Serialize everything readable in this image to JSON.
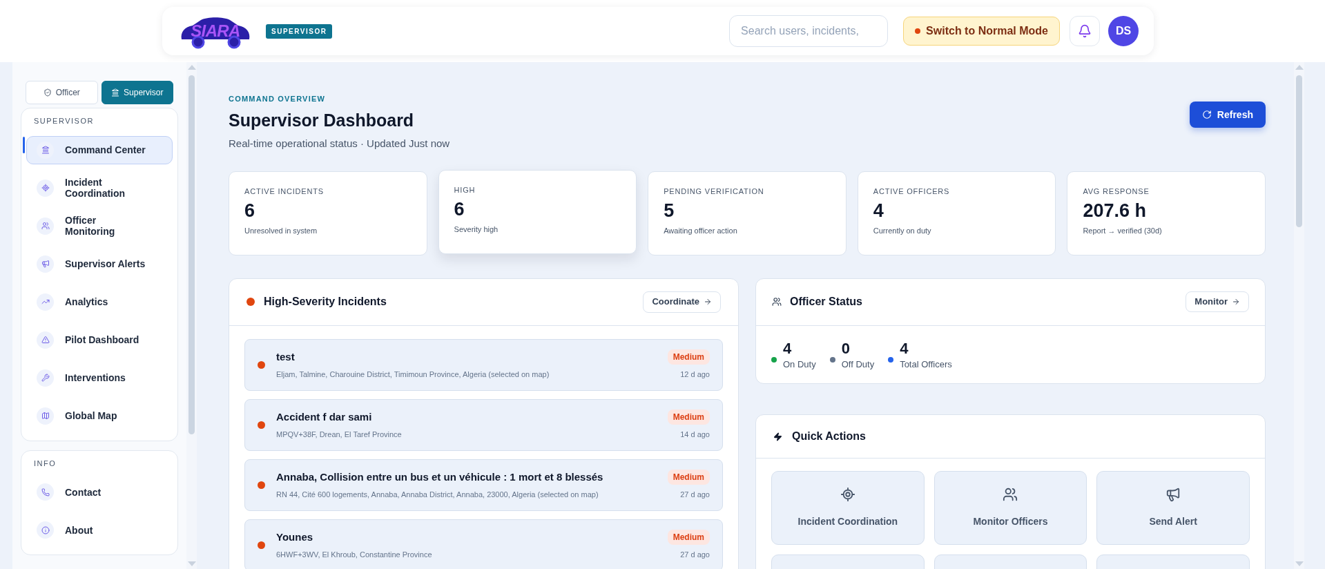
{
  "header": {
    "logo": "SIARA",
    "role_badge": "SUPERVISOR",
    "search": {
      "placeholder": "Search users, incidents,"
    },
    "mode_button": "Switch to Normal Mode",
    "avatar": "DS"
  },
  "sidebar": {
    "mode_tabs": [
      {
        "label": "Officer",
        "selected": false
      },
      {
        "label": "Supervisor",
        "selected": true
      }
    ],
    "sections": [
      {
        "title": "SUPERVISOR",
        "items": [
          {
            "label": "Command Center",
            "selected": true
          },
          {
            "label": "Incident Coordination",
            "selected": false
          },
          {
            "label": "Officer Monitoring",
            "selected": false
          },
          {
            "label": "Supervisor Alerts",
            "selected": false
          },
          {
            "label": "Analytics",
            "selected": false
          },
          {
            "label": "Pilot Dashboard",
            "selected": false
          },
          {
            "label": "Interventions",
            "selected": false
          },
          {
            "label": "Global Map",
            "selected": false
          }
        ]
      },
      {
        "title": "INFO",
        "items": [
          {
            "label": "Contact",
            "selected": false
          },
          {
            "label": "About",
            "selected": false
          }
        ]
      }
    ]
  },
  "page": {
    "eyebrow": "COMMAND OVERVIEW",
    "title": "Supervisor Dashboard",
    "subtitle": "Real-time operational status · Updated Just now",
    "refresh_button": "Refresh"
  },
  "stats": [
    {
      "label": "ACTIVE INCIDENTS",
      "value": "6",
      "caption": "Unresolved in system",
      "raised": false
    },
    {
      "label": "HIGH",
      "value": "6",
      "caption": "Severity high",
      "raised": true
    },
    {
      "label": "PENDING VERIFICATION",
      "value": "5",
      "caption": "Awaiting officer action",
      "raised": false
    },
    {
      "label": "ACTIVE OFFICERS",
      "value": "4",
      "caption": "Currently on duty",
      "raised": false
    },
    {
      "label": "AVG RESPONSE",
      "value": "207.6 h",
      "caption": "Report → verified (30d)",
      "raised": false
    }
  ],
  "incidents": {
    "title": "High-Severity Incidents",
    "button": "Coordinate",
    "items": [
      {
        "title": "test",
        "address": "Eljam, Talmine, Charouine District, Timimoun Province, Algeria (selected on map)",
        "severity": "Medium",
        "time": "12 d ago"
      },
      {
        "title": "Accident f dar sami",
        "address": "MPQV+38F, Drean, El Taref Province",
        "severity": "Medium",
        "time": "14 d ago"
      },
      {
        "title": "Annaba, Collision entre un bus et un véhicule : 1 mort et 8 blessés",
        "address": "RN 44, Cité 600 logements, Annaba, Annaba District, Annaba, 23000, Algeria (selected on map)",
        "severity": "Medium",
        "time": "27 d ago"
      },
      {
        "title": "Younes",
        "address": "6HWF+3WV, El Khroub, Constantine Province",
        "severity": "Medium",
        "time": "27 d ago"
      }
    ]
  },
  "officer_status": {
    "title": "Officer Status",
    "button": "Monitor",
    "stats": [
      {
        "value": "4",
        "label": "On Duty",
        "color": "#16a34a"
      },
      {
        "value": "0",
        "label": "Off Duty",
        "color": "#64748b"
      },
      {
        "value": "4",
        "label": "Total Officers",
        "color": "#2563eb"
      }
    ]
  },
  "quick_actions": {
    "title": "Quick Actions",
    "actions": [
      {
        "label": "Incident Coordination"
      },
      {
        "label": "Monitor Officers"
      },
      {
        "label": "Send Alert"
      }
    ]
  }
}
